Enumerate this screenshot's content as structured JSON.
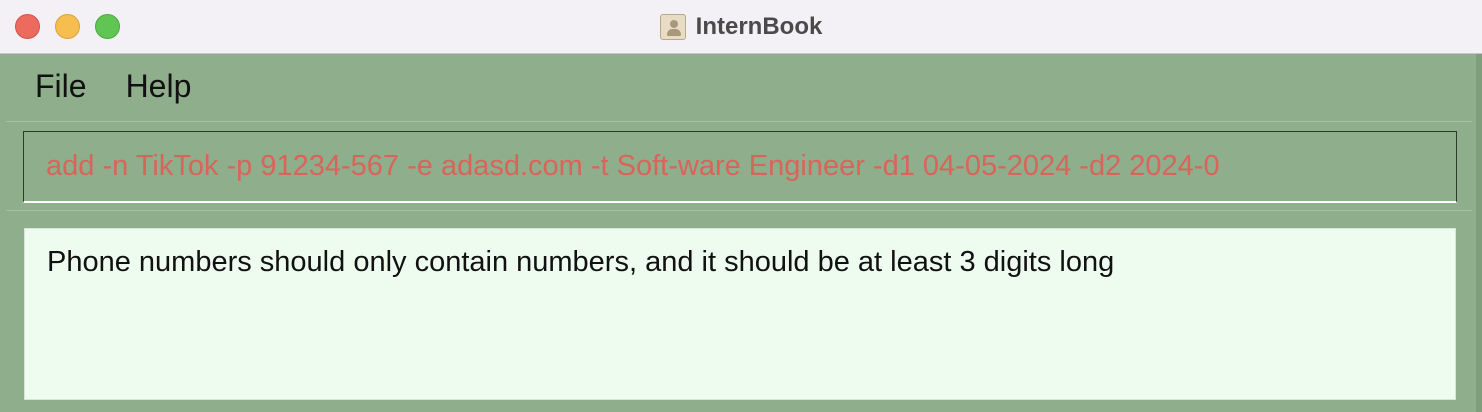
{
  "window": {
    "title": "InternBook",
    "app_icon": "address-book-icon"
  },
  "menu": {
    "items": [
      {
        "label": "File"
      },
      {
        "label": "Help"
      }
    ]
  },
  "command": {
    "value": "add -n TikTok -p 91234-567 -e adasd.com -t Soft-ware Engineer -d1 04-05-2024 -d2 2024-0"
  },
  "result": {
    "message": "Phone numbers should only contain numbers, and it should be at least 3 digits long"
  },
  "colors": {
    "background": "#8fae8c",
    "command_error_text": "#d9645a",
    "result_background": "#eefcef"
  }
}
